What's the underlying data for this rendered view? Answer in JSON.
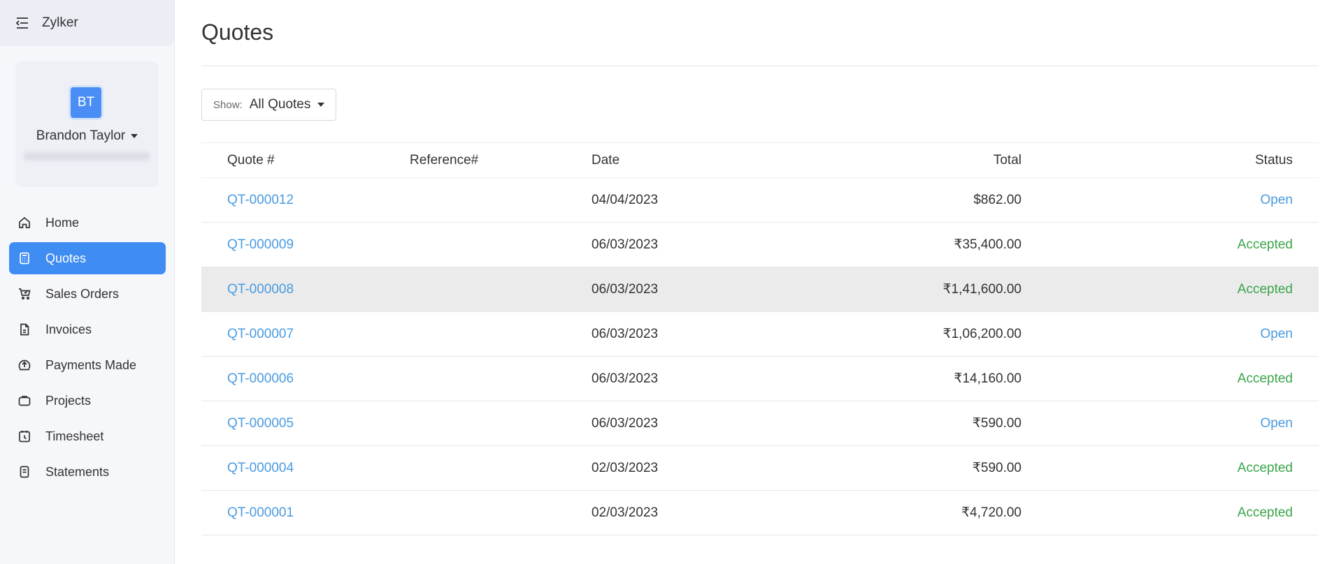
{
  "sidebar": {
    "org_name": "Zylker",
    "profile": {
      "initials": "BT",
      "name": "Brandon Taylor"
    },
    "items": [
      {
        "label": "Home",
        "icon": "home-icon",
        "active": false
      },
      {
        "label": "Quotes",
        "icon": "calculator-icon",
        "active": true
      },
      {
        "label": "Sales Orders",
        "icon": "cart-icon",
        "active": false
      },
      {
        "label": "Invoices",
        "icon": "document-icon",
        "active": false
      },
      {
        "label": "Payments Made",
        "icon": "upload-circle-icon",
        "active": false
      },
      {
        "label": "Projects",
        "icon": "briefcase-icon",
        "active": false
      },
      {
        "label": "Timesheet",
        "icon": "timesheet-icon",
        "active": false
      },
      {
        "label": "Statements",
        "icon": "statement-icon",
        "active": false
      }
    ]
  },
  "main": {
    "title": "Quotes",
    "filter": {
      "label": "Show:",
      "value": "All Quotes"
    },
    "table": {
      "headers": {
        "quote": "Quote #",
        "reference": "Reference#",
        "date": "Date",
        "total": "Total",
        "status": "Status"
      },
      "rows": [
        {
          "quote": "QT-000012",
          "reference": "",
          "date": "04/04/2023",
          "total": "$862.00",
          "status": "Open"
        },
        {
          "quote": "QT-000009",
          "reference": "",
          "date": "06/03/2023",
          "total": "₹35,400.00",
          "status": "Accepted"
        },
        {
          "quote": "QT-000008",
          "reference": "",
          "date": "06/03/2023",
          "total": "₹1,41,600.00",
          "status": "Accepted"
        },
        {
          "quote": "QT-000007",
          "reference": "",
          "date": "06/03/2023",
          "total": "₹1,06,200.00",
          "status": "Open"
        },
        {
          "quote": "QT-000006",
          "reference": "",
          "date": "06/03/2023",
          "total": "₹14,160.00",
          "status": "Accepted"
        },
        {
          "quote": "QT-000005",
          "reference": "",
          "date": "06/03/2023",
          "total": "₹590.00",
          "status": "Open"
        },
        {
          "quote": "QT-000004",
          "reference": "",
          "date": "02/03/2023",
          "total": "₹590.00",
          "status": "Accepted"
        },
        {
          "quote": "QT-000001",
          "reference": "",
          "date": "02/03/2023",
          "total": "₹4,720.00",
          "status": "Accepted"
        }
      ]
    }
  },
  "colors": {
    "accent": "#3f8cf3",
    "link": "#4a9be0",
    "accepted": "#3aa54a",
    "hover_row": "#ebebeb"
  }
}
